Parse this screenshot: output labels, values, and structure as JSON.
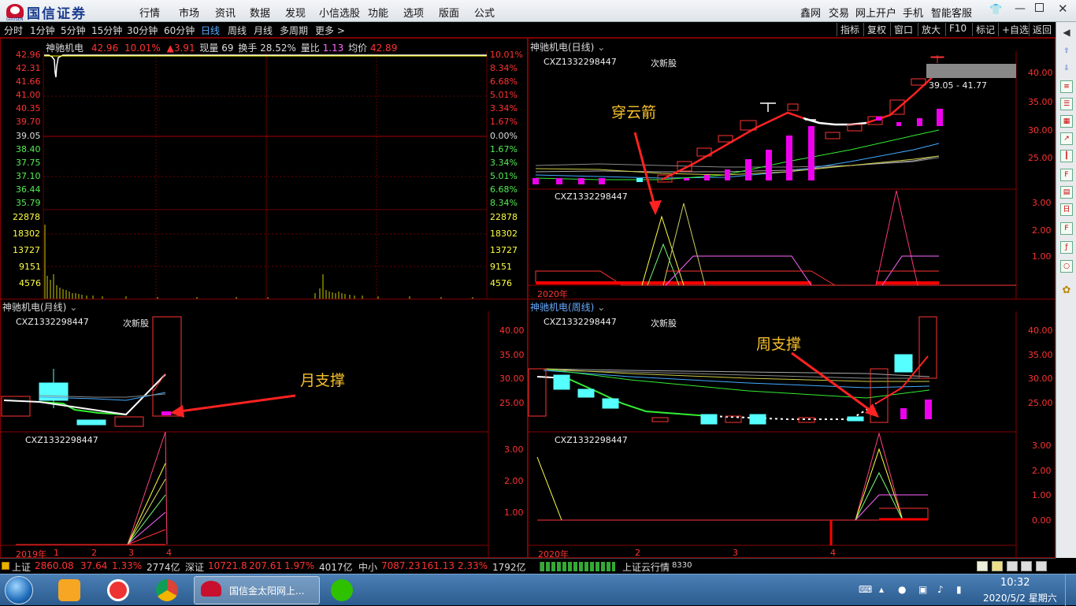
{
  "app": {
    "logo_text": "国信证券",
    "logo_sub": "GUOSEN",
    "menu": [
      "行情",
      "市场",
      "资讯",
      "数据",
      "发现",
      "小信选股",
      "功能",
      "选项",
      "版面",
      "公式"
    ],
    "right_menu": [
      "鑫网",
      "交易",
      "网上开户",
      "手机",
      "智能客服"
    ]
  },
  "toolbar": {
    "periods": [
      "分时",
      "1分钟",
      "5分钟",
      "15分钟",
      "30分钟",
      "60分钟",
      "日线",
      "周线",
      "月线",
      "多周期",
      "更多 >"
    ],
    "active_period": "日线",
    "right_buttons": [
      "指标",
      "复权",
      "窗口",
      "放大",
      "F10",
      "标记",
      "+自选",
      "返回"
    ]
  },
  "intraday": {
    "title": "神驰机电",
    "price": "42.96",
    "pct": "10.01%",
    "change": "▲3.91",
    "volume_label": "现量 69",
    "turnover": "换手 28.52%",
    "ratio_label": "量比",
    "ratio_value": "1.13",
    "avg_label": "均价",
    "avg_value": "42.89",
    "left_prices": [
      "42.96",
      "42.31",
      "41.66",
      "41.00",
      "40.35",
      "39.70",
      "39.05",
      "38.40",
      "37.75",
      "37.10",
      "36.44",
      "35.79"
    ],
    "right_pcts": [
      "10.01%",
      "8.34%",
      "6.68%",
      "5.01%",
      "3.34%",
      "1.67%",
      "0.00%",
      "1.67%",
      "3.34%",
      "5.01%",
      "6.68%",
      "8.34%"
    ],
    "vol_left": [
      "22878",
      "18302",
      "13727",
      "9151",
      "4576"
    ],
    "vol_right": [
      "22878",
      "18302",
      "13727",
      "9151",
      "4576"
    ]
  },
  "daily": {
    "title": "神驰机电(日线)",
    "code": "CXZ1332298447",
    "tag": "次新股",
    "sub_code": "CXZ1332298447",
    "yaxis": [
      "40.00",
      "35.00",
      "30.00",
      "25.00"
    ],
    "sub_yaxis": [
      "3.00",
      "2.00",
      "1.00"
    ],
    "range_box": "39.05 - 41.77",
    "year": "2020年",
    "annotation": "穿云箭"
  },
  "monthly": {
    "title": "神驰机电(月线)",
    "code": "CXZ1332298447",
    "tag": "次新股",
    "sub_code": "CXZ1332298447",
    "yaxis": [
      "40.00",
      "35.00",
      "30.00",
      "25.00"
    ],
    "sub_yaxis": [
      "3.00",
      "2.00",
      "1.00"
    ],
    "xaxis": [
      "2019年",
      "1",
      "2",
      "3",
      "4"
    ],
    "annotation": "月支撑"
  },
  "weekly": {
    "title": "神驰机电(周线)",
    "code": "CXZ1332298447",
    "tag": "次新股",
    "sub_code": "CXZ1332298447",
    "yaxis": [
      "40.00",
      "35.00",
      "30.00",
      "25.00"
    ],
    "sub_yaxis": [
      "3.00",
      "2.00",
      "1.00",
      "0.00"
    ],
    "xaxis": [
      "2020年",
      "2",
      "3",
      "4"
    ],
    "annotation": "周支撑"
  },
  "status": {
    "sh_label": "上证",
    "sh_val": "2860.08",
    "sh_chg": "37.64",
    "sh_pct": "1.33%",
    "sh_amt": "2774亿",
    "sz_label": "深证",
    "sz_val": "10721.8",
    "sz_chg": "207.61",
    "sz_pct": "1.97%",
    "sz_amt": "4017亿",
    "zx_label": "中小",
    "zx_val": "7087.23",
    "zx_chg": "161.13",
    "zx_pct": "2.33%",
    "zx_amt": "1792亿",
    "cloud": "上证云行情",
    "cloud_num": "8330"
  },
  "taskbar": {
    "active_app": "国信金太阳网上...",
    "time": "10:32",
    "date": "2020/5/2 星期六"
  },
  "colors": {
    "up": "#ff3b3b",
    "down": "#55ffff",
    "grid": "#800000",
    "ma": "#ffffff"
  }
}
